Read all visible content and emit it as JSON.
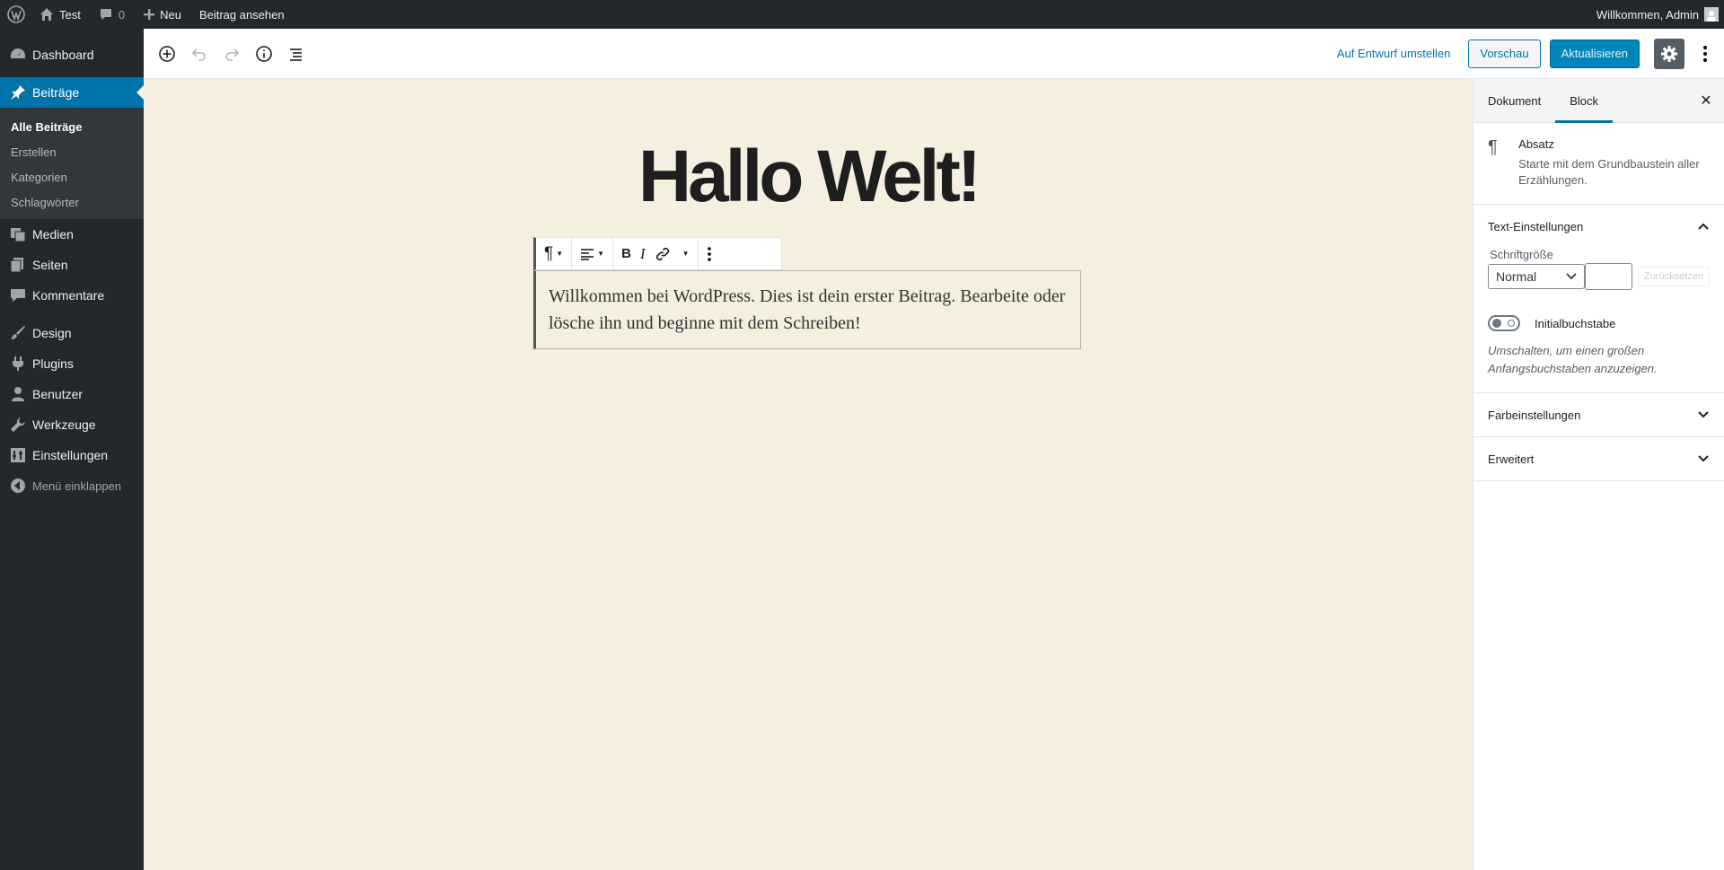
{
  "adminbar": {
    "site_name": "Test",
    "comments_count": "0",
    "new_label": "Neu",
    "view_post_label": "Beitrag ansehen",
    "greeting": "Willkommen, Admin"
  },
  "sidebar": {
    "dashboard": "Dashboard",
    "posts": "Beiträge",
    "posts_sub": [
      "Alle Beiträge",
      "Erstellen",
      "Kategorien",
      "Schlagwörter"
    ],
    "media": "Medien",
    "pages": "Seiten",
    "comments": "Kommentare",
    "design": "Design",
    "plugins": "Plugins",
    "users": "Benutzer",
    "tools": "Werkzeuge",
    "settings": "Einstellungen",
    "collapse": "Menü einklappen"
  },
  "header": {
    "switch_draft": "Auf Entwurf umstellen",
    "preview": "Vorschau",
    "update": "Aktualisieren"
  },
  "editor": {
    "title": "Hallo Welt!",
    "paragraph": "Willkommen bei WordPress. Dies ist dein erster Beitrag. Bearbeite oder lösche ihn und beginne mit dem Schreiben!"
  },
  "inspector": {
    "tab_document": "Dokument",
    "tab_block": "Block",
    "block_name": "Absatz",
    "block_desc": "Starte mit dem Grundbaustein aller Erzählungen.",
    "text_settings": "Text-Einstellungen",
    "font_size_label": "Schriftgröße",
    "font_size_value": "Normal",
    "reset": "Zurücksetzen",
    "drop_cap": "Initialbuchstabe",
    "drop_cap_help": "Umschalten, um einen großen Anfangsbuchstaben anzuzeigen.",
    "color_settings": "Farbeinstellungen",
    "advanced": "Erweitert"
  },
  "colors": {
    "admin_dark": "#23282d",
    "accent": "#0073aa",
    "canvas_bg": "#f5efe0"
  }
}
